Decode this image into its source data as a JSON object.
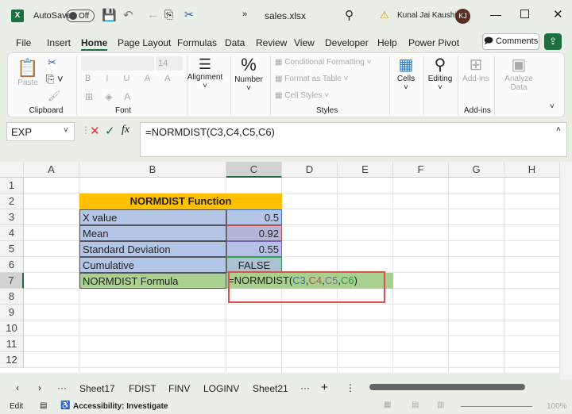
{
  "titlebar": {
    "autosave": "AutoSave",
    "toggle": "Off",
    "filename": "sales.xlsx",
    "user": "Kunal Jai Kaushik",
    "initials": "KJ"
  },
  "tabs": [
    "File",
    "Insert",
    "Home",
    "Page Layout",
    "Formulas",
    "Data",
    "Review",
    "View",
    "Developer",
    "Help",
    "Power Pivot"
  ],
  "comments": "Comments",
  "ribbon": {
    "paste": "Paste",
    "clipboard": "Clipboard",
    "font_size": "14",
    "font": "Font",
    "alignment": "Alignment",
    "number": "Number",
    "cond": "Conditional Formatting",
    "fmt_table": "Format as Table",
    "cell_styles": "Cell Styles",
    "styles": "Styles",
    "cells": "Cells",
    "editing": "Editing",
    "addins": "Add-ins",
    "analyze": "Analyze Data",
    "addins_group": "Add-ins"
  },
  "namebox": "EXP",
  "formula": "=NORMDIST(C3,C4,C5,C6)",
  "columns": [
    "A",
    "B",
    "C",
    "D",
    "E",
    "F",
    "G",
    "H"
  ],
  "rows": [
    "1",
    "2",
    "3",
    "4",
    "5",
    "6",
    "7",
    "8",
    "9",
    "10",
    "11",
    "12"
  ],
  "table": {
    "header": "NORMDIST Function",
    "labels": [
      "X value",
      "Mean",
      "Standard Deviation",
      "Cumulative",
      "NORMDIST Formula"
    ],
    "values": [
      "0.5",
      "0.92",
      "0.55",
      "FALSE"
    ],
    "formula_parts": [
      "=NORMDIST(",
      "C3",
      ",",
      "C4",
      ",",
      "C5",
      ",",
      "C6",
      ")"
    ]
  },
  "sheets": [
    "Sheet17",
    "FDIST",
    "FINV",
    "LOGINV",
    "Sheet21"
  ],
  "status": {
    "mode": "Edit",
    "accessibility": "Accessibility: Investigate",
    "zoom": "100%"
  },
  "colors": {
    "header": "#ffc000",
    "blue": "#b4c6e7",
    "green": "#a9d08e",
    "excel": "#1d6f42"
  }
}
